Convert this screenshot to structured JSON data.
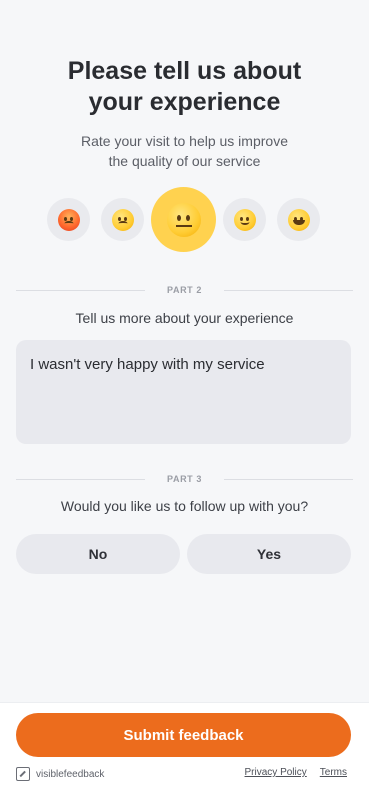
{
  "header": {
    "title": "Please tell us about your experience",
    "subtitle": "Rate your visit to help us improve the quality of our service"
  },
  "rating": {
    "options": [
      "angry",
      "confused",
      "neutral",
      "slightly-smiling",
      "grinning"
    ],
    "selected": "neutral"
  },
  "part2": {
    "label": "PART 2",
    "question": "Tell us more about your experience",
    "answer": "I wasn't very happy with my service"
  },
  "part3": {
    "label": "PART 3",
    "question": "Would you like us to follow up with you?",
    "no_label": "No",
    "yes_label": "Yes"
  },
  "footer": {
    "submit_label": "Submit feedback",
    "brand": "visiblefeedback",
    "privacy_label": "Privacy Policy",
    "terms_label": "Terms"
  },
  "colors": {
    "accent": "#ec6c1d",
    "selected_rating": "#ffd24f"
  }
}
